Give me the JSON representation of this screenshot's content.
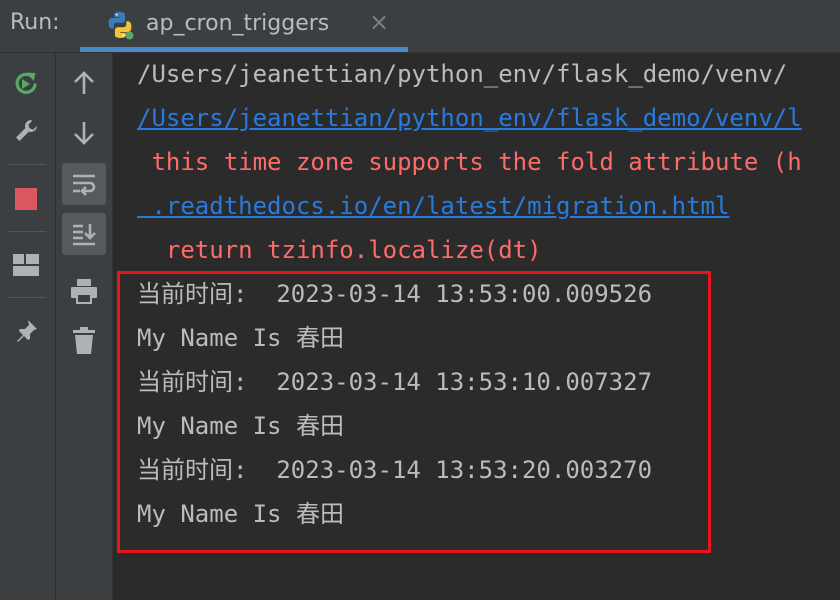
{
  "run_bar": {
    "label": "Run:",
    "tab": {
      "title": "ap_cron_triggers",
      "icon": "python-icon",
      "close_glyph": "×"
    }
  },
  "toolbar_left": [
    {
      "name": "rerun-icon",
      "color": "#59a869"
    },
    {
      "name": "wrench-icon",
      "color": "#afb1b3"
    },
    {
      "name": "stop-icon",
      "color": "#db5860"
    },
    {
      "name": "layout-icon",
      "color": "#afb1b3"
    },
    {
      "name": "pin-icon",
      "color": "#afb1b3"
    }
  ],
  "toolbar_right": [
    {
      "name": "arrow-up-icon"
    },
    {
      "name": "arrow-down-icon"
    },
    {
      "name": "soft-wrap-icon",
      "active": true
    },
    {
      "name": "scroll-to-end-icon",
      "active": true
    },
    {
      "name": "print-icon"
    },
    {
      "name": "trash-icon"
    }
  ],
  "console": {
    "lines": [
      {
        "text": "/Users/jeanettian/python_env/flask_demo/venv/",
        "style": "gray"
      },
      {
        "text": "/Users/jeanettian/python_env/flask_demo/venv/l",
        "style": "link"
      },
      {
        "text": " this time zone supports the fold attribute (h",
        "style": "red"
      },
      {
        "text": " .readthedocs.io/en/latest/migration.html",
        "style": "link"
      },
      {
        "text": "  return tzinfo.localize(dt)",
        "style": "red"
      },
      {
        "text": "当前时间:  2023-03-14 13:53:00.009526",
        "style": "gray"
      },
      {
        "text": "My Name Is 春田",
        "style": "gray"
      },
      {
        "text": "当前时间:  2023-03-14 13:53:10.007327",
        "style": "gray"
      },
      {
        "text": "My Name Is 春田",
        "style": "gray"
      },
      {
        "text": "当前时间:  2023-03-14 13:53:20.003270",
        "style": "gray"
      },
      {
        "text": "My Name Is 春田",
        "style": "gray"
      }
    ]
  },
  "colors": {
    "background": "#2b2b2b",
    "panel": "#3c3f41",
    "text": "#bbbbbb",
    "link": "#287bde",
    "error": "#ff6b68",
    "highlight_box": "#e8141c",
    "tab_underline": "#4a88c7"
  }
}
